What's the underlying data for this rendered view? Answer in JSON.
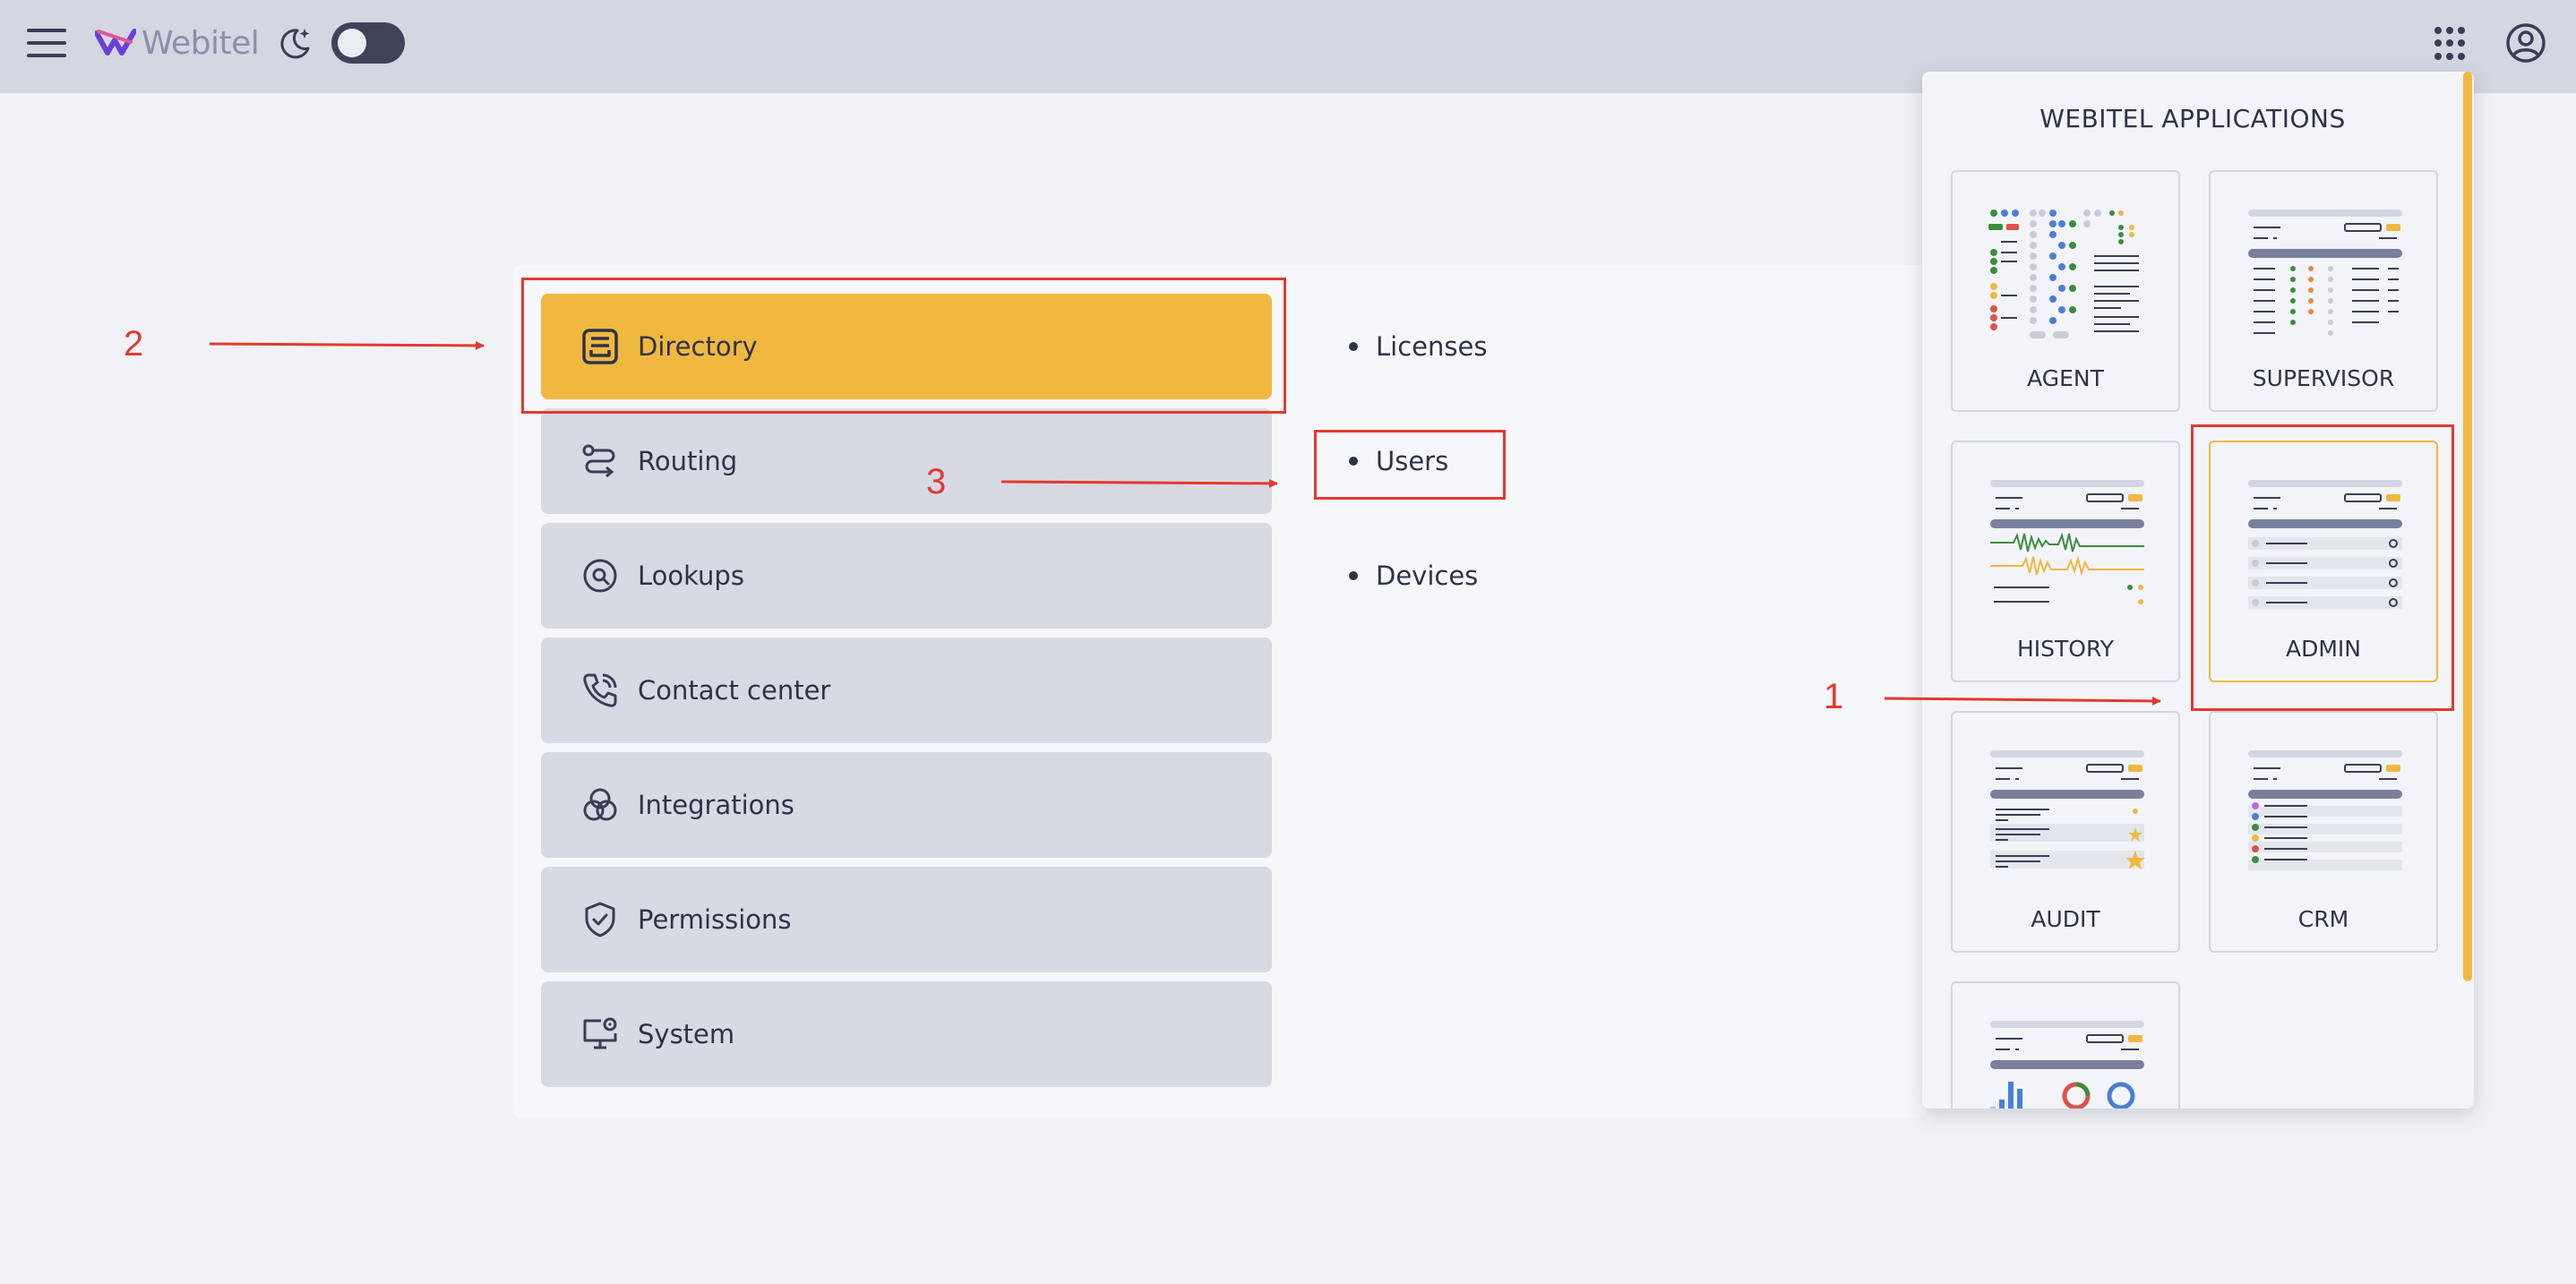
{
  "header": {
    "logo_text": "Webitel",
    "menu_icon": "hamburger-icon",
    "theme_icon": "moon-stars-icon",
    "apps_icon": "grid-dots-icon",
    "account_icon": "user-circle-icon"
  },
  "nav": {
    "items": [
      {
        "label": "Directory",
        "icon": "directory-icon",
        "active": true
      },
      {
        "label": "Routing",
        "icon": "routing-icon"
      },
      {
        "label": "Lookups",
        "icon": "lookups-icon"
      },
      {
        "label": "Contact center",
        "icon": "phone-icon"
      },
      {
        "label": "Integrations",
        "icon": "integrations-icon"
      },
      {
        "label": "Permissions",
        "icon": "shield-check-icon"
      },
      {
        "label": "System",
        "icon": "monitor-gear-icon"
      }
    ]
  },
  "subnav": {
    "items": [
      {
        "label": "Licenses"
      },
      {
        "label": "Users"
      },
      {
        "label": "Devices"
      }
    ]
  },
  "apps": {
    "title": "WEBITEL APPLICATIONS",
    "items": [
      {
        "label": "AGENT"
      },
      {
        "label": "SUPERVISOR"
      },
      {
        "label": "HISTORY"
      },
      {
        "label": "ADMIN",
        "selected": true
      },
      {
        "label": "AUDIT"
      },
      {
        "label": "CRM"
      },
      {
        "label": ""
      }
    ]
  },
  "annotations": {
    "one": "1",
    "two": "2",
    "three": "3"
  },
  "colors": {
    "accent": "#f0b840",
    "annotation": "#e23a2e",
    "header_bg": "#d4d6e1",
    "nav_bg": "#d7d9e3"
  }
}
